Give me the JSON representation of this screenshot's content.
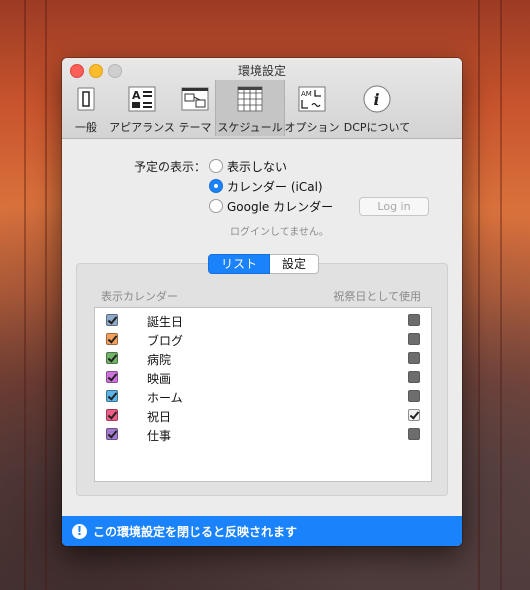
{
  "window": {
    "title": "環境設定"
  },
  "toolbar": {
    "items": [
      {
        "label": "一般",
        "icon": "general-icon"
      },
      {
        "label": "アピアランス",
        "icon": "appearance-icon"
      },
      {
        "label": "テーマ",
        "icon": "theme-icon"
      },
      {
        "label": "スケジュール",
        "icon": "schedule-icon",
        "active": true
      },
      {
        "label": "オプション",
        "icon": "options-icon"
      },
      {
        "label": "DCPについて",
        "icon": "info-icon"
      }
    ]
  },
  "schedule": {
    "display_label": "予定の表示：",
    "options": [
      {
        "label": "表示しない",
        "selected": false
      },
      {
        "label": "カレンダー (iCal)",
        "selected": true
      },
      {
        "label": "Google カレンダー",
        "selected": false
      }
    ],
    "login_button": "Log in",
    "login_status": "ログインしてません。"
  },
  "tabs": {
    "list": "リスト",
    "settings": "設定"
  },
  "calendar_list": {
    "header_left": "表示カレンダー",
    "header_right": "祝祭日として使用",
    "items": [
      {
        "name": "誕生日",
        "color": "#8fa9c9",
        "shown": true,
        "holiday": false
      },
      {
        "name": "ブログ",
        "color": "#f4a15d",
        "shown": true,
        "holiday": false
      },
      {
        "name": "病院",
        "color": "#73b26a",
        "shown": true,
        "holiday": false
      },
      {
        "name": "映画",
        "color": "#cf74dd",
        "shown": true,
        "holiday": false
      },
      {
        "name": "ホーム",
        "color": "#5ab4e8",
        "shown": true,
        "holiday": false
      },
      {
        "name": "祝日",
        "color": "#ef5c84",
        "shown": true,
        "holiday": true
      },
      {
        "name": "仕事",
        "color": "#a27ad0",
        "shown": true,
        "holiday": false
      }
    ]
  },
  "notice": {
    "icon": "exclamation-icon",
    "text": "この環境設定を閉じると反映されます"
  }
}
